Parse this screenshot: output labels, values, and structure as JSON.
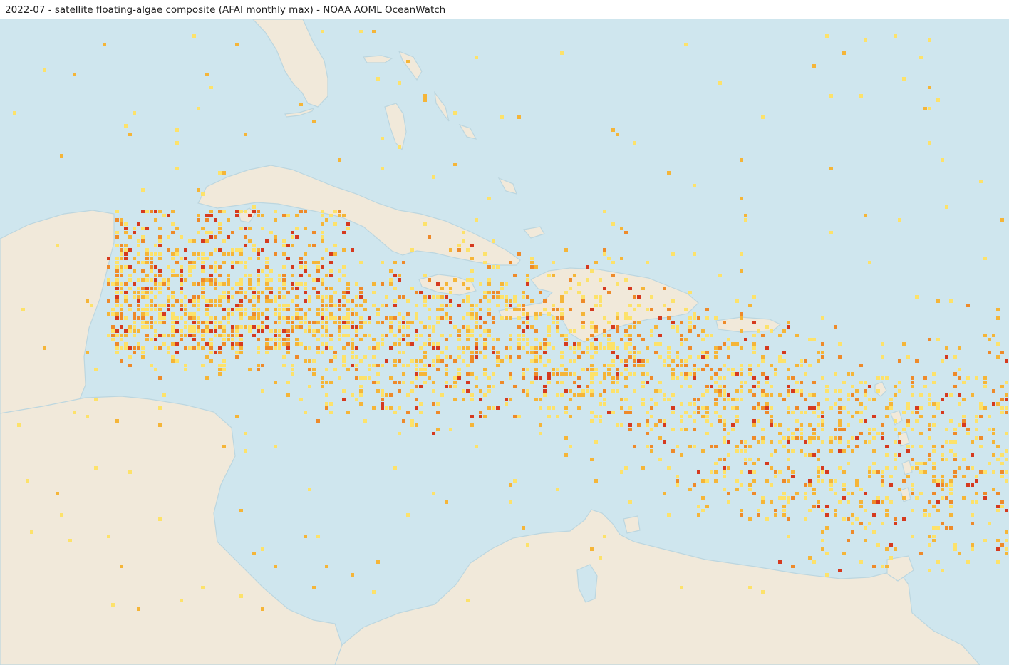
{
  "header": {
    "title": "2022-07 - satellite floating-algae composite (AFAI monthly max) - NOAA AOML OceanWatch"
  },
  "map": {
    "colors": {
      "ocean": "#cfe6ee",
      "land": "#f1e9da",
      "coast": "#bcd6df",
      "algae_low": "#fde26a",
      "algae_mid": "#f5b538",
      "algae_high": "#ee8a2a",
      "algae_max": "#d53a1f"
    }
  }
}
